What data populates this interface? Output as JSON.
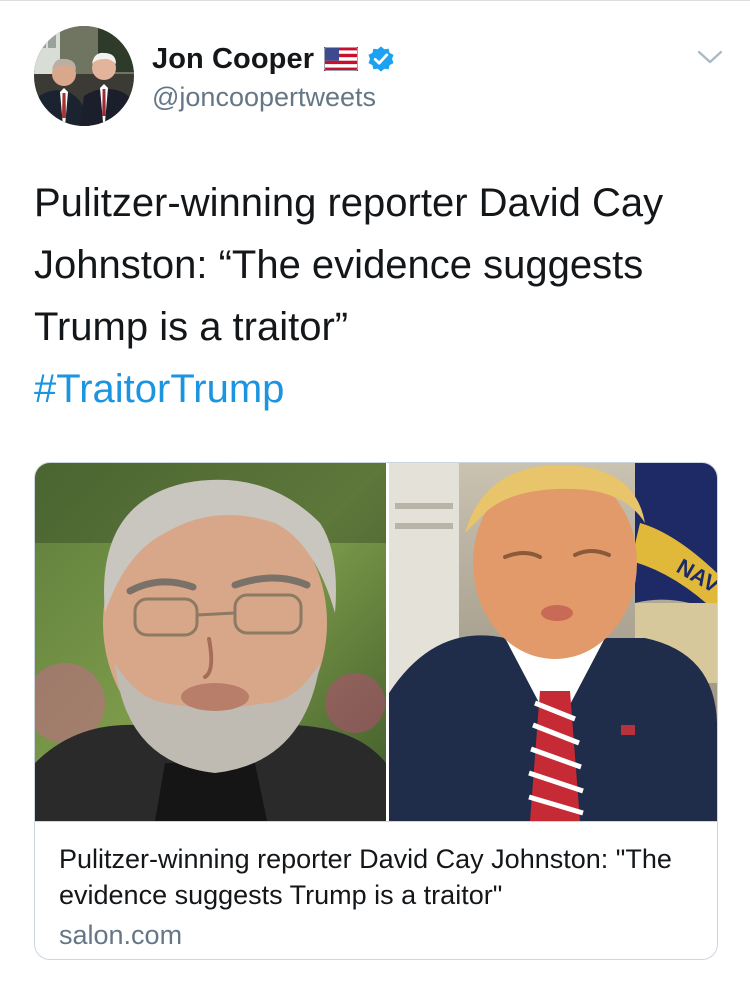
{
  "tweet": {
    "author": {
      "display_name": "Jon Cooper",
      "handle": "@joncoopertweets",
      "verified": true,
      "flag_icon": "us-flag-icon"
    },
    "text": "Pulitzer-winning reporter David Cay Johnston: “The evidence suggests Trump is a traitor”",
    "hashtag": "#TraitorTrump"
  },
  "link_card": {
    "title": "Pulitzer-winning reporter David Cay Johnston: \"The evidence suggests Trump is a traitor\"",
    "domain": "salon.com",
    "image_text": "NAVY"
  },
  "icons": {
    "menu": "chevron-down-icon",
    "verified": "verified-badge-icon"
  },
  "colors": {
    "text": "#14171a",
    "secondary": "#657786",
    "link": "#1b95e0",
    "verified": "#1da1f2",
    "border": "#ccd6dd"
  }
}
